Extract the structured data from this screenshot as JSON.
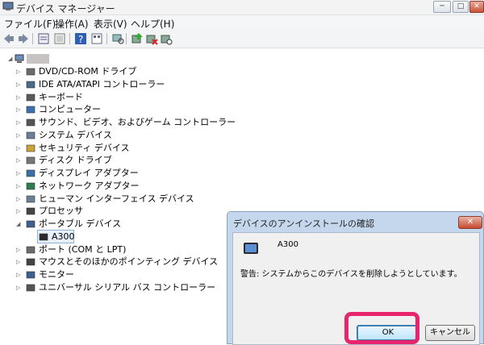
{
  "window": {
    "title": "デバイス マネージャー",
    "minimize": "─",
    "maximize": "□",
    "close": "✕"
  },
  "menu": [
    {
      "label": "ファイル(F)"
    },
    {
      "label": "操作(A)"
    },
    {
      "label": "表示(V)"
    },
    {
      "label": "ヘルプ(H)"
    }
  ],
  "toolbar": {
    "icons": [
      "back-icon",
      "forward-icon",
      "properties-icon",
      "refresh-icon",
      "help-icon",
      "view-icon",
      "scan-hardware-icon",
      "update-driver-icon",
      "uninstall-icon",
      "disable-icon"
    ]
  },
  "tree": {
    "root_expander": "◢",
    "items": [
      {
        "label": "DVD/CD-ROM ドライブ",
        "icon": "dvd-drive-icon"
      },
      {
        "label": "IDE ATA/ATAPI コントローラー",
        "icon": "ide-controller-icon"
      },
      {
        "label": "キーボード",
        "icon": "keyboard-icon"
      },
      {
        "label": "コンピューター",
        "icon": "computer-icon"
      },
      {
        "label": "サウンド、ビデオ、およびゲーム コントローラー",
        "icon": "sound-icon"
      },
      {
        "label": "システム デバイス",
        "icon": "system-devices-icon"
      },
      {
        "label": "セキュリティ デバイス",
        "icon": "security-devices-icon"
      },
      {
        "label": "ディスク ドライブ",
        "icon": "disk-drive-icon"
      },
      {
        "label": "ディスプレイ アダプター",
        "icon": "display-adapter-icon"
      },
      {
        "label": "ネットワーク アダプター",
        "icon": "network-adapter-icon"
      },
      {
        "label": "ヒューマン インターフェイス デバイス",
        "icon": "hid-icon"
      },
      {
        "label": "プロセッサ",
        "icon": "processor-icon"
      },
      {
        "label": "ポータブル デバイス",
        "icon": "portable-devices-icon",
        "expanded": true
      },
      {
        "label": "A300",
        "icon": "tablet-device-icon",
        "child": true,
        "selected": true
      },
      {
        "label": "ポート (COM と LPT)",
        "icon": "port-icon"
      },
      {
        "label": "マウスとそのほかのポインティング デバイス",
        "icon": "mouse-icon"
      },
      {
        "label": "モニター",
        "icon": "monitor-icon"
      },
      {
        "label": "ユニバーサル シリアル バス コントローラー",
        "icon": "usb-icon"
      }
    ],
    "collapsed_glyph": "▷",
    "expanded_glyph": "◢"
  },
  "dialog": {
    "title": "デバイスのアンインストールの確認",
    "close": "✕",
    "device_name": "A300",
    "warning": "警告: システムからこのデバイスを削除しようとしています。",
    "ok_label": "OK",
    "cancel_label": "キャンセル"
  },
  "colors": {
    "highlight": "#e8246f",
    "selection": "#e8f1fb"
  }
}
